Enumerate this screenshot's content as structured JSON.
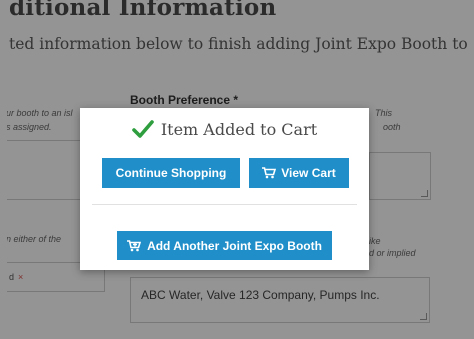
{
  "background": {
    "heading": "ditional Information",
    "intro": "ted information below to finish adding Joint Expo Booth to",
    "booth_preference_label": "Booth Preference *",
    "hint_left_top_1": "ur booth to an isl",
    "hint_left_top_2": "s assigned.",
    "hint_right_top_1": "This",
    "hint_right_top_2": "ooth",
    "hint_left_mid": "n either of the",
    "hint_right_mid_1": "ike",
    "hint_right_mid_2": "d or implied",
    "tag_text": "d",
    "tag_remove": "×",
    "companies_value": "ABC Water, Valve 123 Company, Pumps Inc."
  },
  "modal": {
    "title": "Item Added to Cart",
    "continue_label": "Continue Shopping",
    "view_cart_label": "View Cart",
    "add_another_label": "Add Another Joint Expo Booth"
  },
  "colors": {
    "accent": "#1f8ec9",
    "success": "#2e9e3e",
    "overlay": "rgba(0,0,0,0.42)"
  },
  "icons": {
    "title": "checkmark-icon",
    "view_cart": "cart-icon",
    "add_another": "cart-add-icon"
  }
}
